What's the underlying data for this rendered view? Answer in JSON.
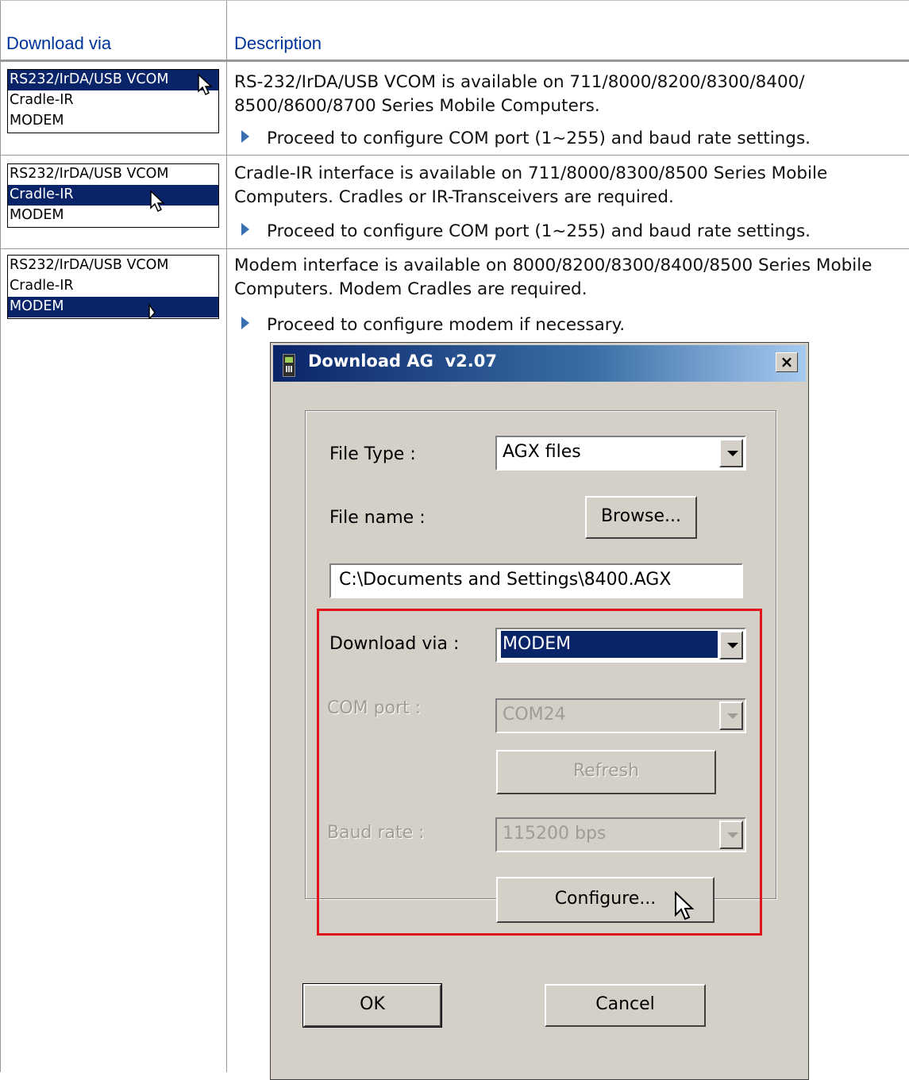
{
  "table": {
    "headers": {
      "download_via": "Download via",
      "description": "Description"
    },
    "rows": [
      {
        "options": [
          "RS232/IrDA/USB VCOM",
          "Cradle-IR",
          "MODEM"
        ],
        "selected": 0,
        "description": "RS-232/IrDA/USB VCOM is available on 711/8000/8200/8300/8400/ 8500/8600/8700 Series Mobile Computers.",
        "bullet": "Proceed to configure COM port (1~255) and baud rate settings."
      },
      {
        "options": [
          "RS232/IrDA/USB VCOM",
          "Cradle-IR",
          "MODEM"
        ],
        "selected": 1,
        "description": "Cradle-IR interface is available on 711/8000/8300/8500 Series Mobile Computers. Cradles or IR-Transceivers are required.",
        "bullet": "Proceed to configure COM port (1~255) and baud rate settings."
      },
      {
        "options": [
          "RS232/IrDA/USB VCOM",
          "Cradle-IR",
          "MODEM"
        ],
        "selected": 2,
        "description": "Modem interface is available on 8000/8200/8300/8400/8500 Series Mobile Computers. Modem Cradles are required.",
        "bullet": "Proceed to configure modem if necessary."
      }
    ]
  },
  "dialog": {
    "title": "Download AG  v2.07",
    "close_label": "×",
    "file_type_label": "File Type :",
    "file_type_value": "AGX files",
    "file_name_label": "File name :",
    "browse_label": "Browse...",
    "path_value": "C:\\Documents and Settings\\8400.AGX",
    "download_via_label": "Download via :",
    "download_via_value": "MODEM",
    "com_port_label": "COM port :",
    "com_port_value": "COM24",
    "refresh_label": "Refresh",
    "baud_rate_label": "Baud rate :",
    "baud_rate_value": "115200 bps",
    "configure_label": "Configure...",
    "ok_label": "OK",
    "cancel_label": "Cancel"
  },
  "colors": {
    "header_text": "#003399",
    "selection": "#0a246a",
    "highlight_box": "#e0141c",
    "bullet": "#3a6fb0"
  },
  "icons": {
    "bullet": "triangle-right",
    "cursor": "arrow-pointer",
    "app": "mobile-computer"
  }
}
